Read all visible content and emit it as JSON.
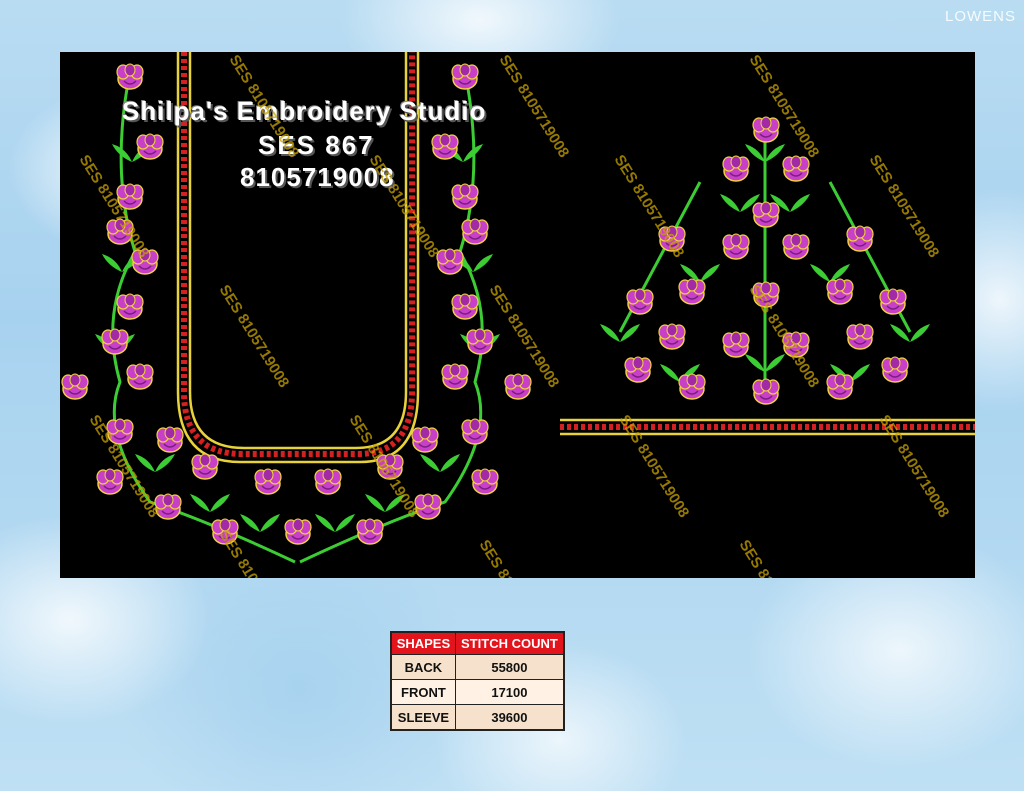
{
  "corner_mark": "LOWENS",
  "design": {
    "title": "Shilpa's Embroidery Studio",
    "code": "SES 867",
    "phone": "8105719008",
    "watermark_text": "SES 8105719008",
    "colors": {
      "background": "#000000",
      "flower": "#c83fc8",
      "flower_outline": "#f0d23c",
      "leaf": "#3ccc33",
      "border_red": "#d42020",
      "border_gold": "#e8d23a"
    }
  },
  "stitch_table": {
    "headers": [
      "SHAPES",
      "STITCH COUNT"
    ],
    "rows": [
      {
        "shape": "BACK",
        "count": "55800"
      },
      {
        "shape": "FRONT",
        "count": "17100"
      },
      {
        "shape": "SLEEVE",
        "count": "39600"
      }
    ]
  }
}
